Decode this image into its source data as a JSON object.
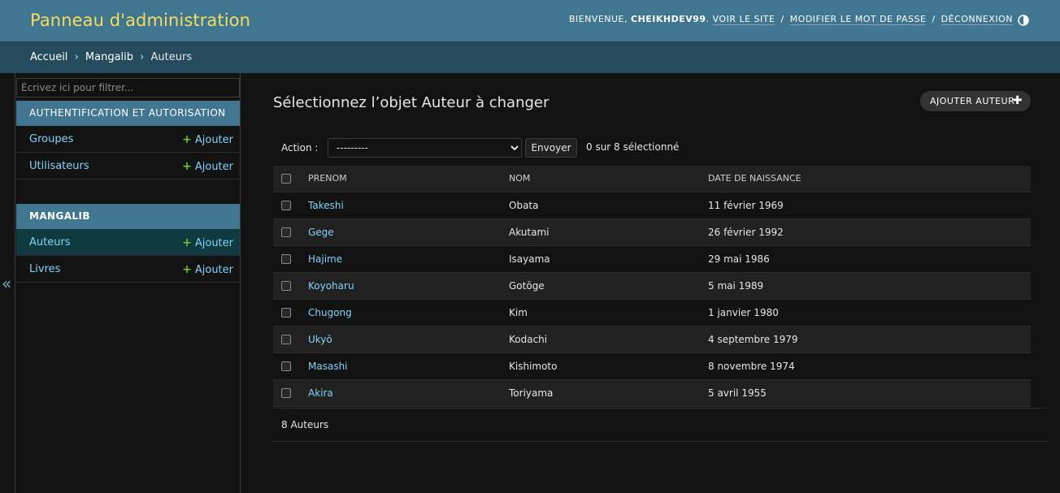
{
  "header": {
    "site_title": "Panneau d'administration",
    "welcome": "BIENVENUE,",
    "username": "CHEIKHDEV99",
    "view_site": "VOIR LE SITE",
    "change_password": "MODIFIER LE MOT DE PASSE",
    "logout": "DÉCONNEXION",
    "separator": "/"
  },
  "breadcrumbs": {
    "items": [
      "Accueil",
      "Mangalib",
      "Auteurs"
    ],
    "separator": "›"
  },
  "sidebar": {
    "filter_placeholder": "Écrivez ici pour filtrer...",
    "collapse_glyph": "«",
    "modules": [
      {
        "caption": "AUTHENTIFICATION ET AUTORISATION",
        "rows": [
          {
            "name": "Groupes",
            "add": "Ajouter"
          },
          {
            "name": "Utilisateurs",
            "add": "Ajouter"
          }
        ]
      },
      {
        "caption": "MANGALIB",
        "rows": [
          {
            "name": "Auteurs",
            "add": "Ajouter"
          },
          {
            "name": "Livres",
            "add": "Ajouter"
          }
        ]
      }
    ],
    "add_glyph": "+"
  },
  "content": {
    "title": "Sélectionnez l’objet Auteur à changer",
    "add_button": "AJOUTER AUTEUR",
    "add_glyph": "✚",
    "actions": {
      "label": "Action :",
      "selected_option": "---------",
      "submit": "Envoyer",
      "counter": "0 sur 8 sélectionné"
    },
    "table": {
      "columns": [
        "PRENOM",
        "NOM",
        "DATE DE NAISSANCE"
      ],
      "rows": [
        {
          "prenom": "Takeshi",
          "nom": "Obata",
          "date": "11 février 1969"
        },
        {
          "prenom": "Gege",
          "nom": "Akutami",
          "date": "26 février 1992"
        },
        {
          "prenom": "Hajime",
          "nom": "Isayama",
          "date": "29 mai 1986"
        },
        {
          "prenom": "Koyoharu",
          "nom": "Gotōge",
          "date": "5 mai 1989"
        },
        {
          "prenom": "Chugong",
          "nom": "Kim",
          "date": "1 janvier 1980"
        },
        {
          "prenom": "Ukyō",
          "nom": "Kodachi",
          "date": "4 septembre 1979"
        },
        {
          "prenom": "Masashi",
          "nom": "Kishimoto",
          "date": "8 novembre 1974"
        },
        {
          "prenom": "Akira",
          "nom": "Toriyama",
          "date": "5 avril 1955"
        }
      ]
    },
    "paginator": "8 Auteurs"
  },
  "colors": {
    "header_bg": "#417690",
    "breadcrumbs_bg": "#264b5d",
    "site_title": "#f5dd5d",
    "link": "#81d4fa",
    "add_plus": "#70bf2b",
    "page_bg": "#121212"
  }
}
